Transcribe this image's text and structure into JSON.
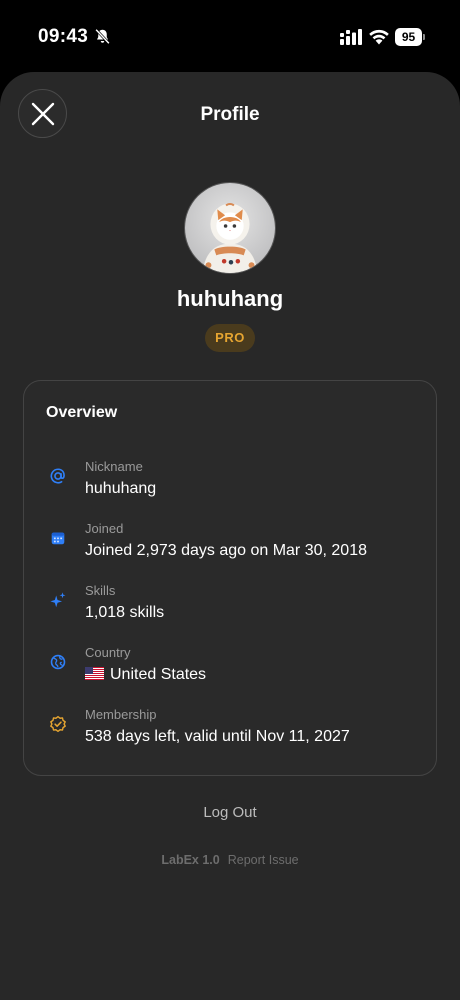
{
  "status_bar": {
    "time": "09:43",
    "battery": "95"
  },
  "header": {
    "title": "Profile"
  },
  "profile": {
    "username": "huhuhang",
    "badge": "PRO"
  },
  "overview": {
    "title": "Overview",
    "rows": [
      {
        "label": "Nickname",
        "value": "huhuhang",
        "icon": "at-icon"
      },
      {
        "label": "Joined",
        "value": "Joined 2,973 days ago on Mar 30, 2018",
        "icon": "calendar-icon"
      },
      {
        "label": "Skills",
        "value": "1,018 skills",
        "icon": "sparkles-icon"
      },
      {
        "label": "Country",
        "value": "United States",
        "icon": "globe-icon",
        "flag": "us-flag"
      },
      {
        "label": "Membership",
        "value": "538 days left, valid until Nov 11, 2027",
        "icon": "verified-badge-icon"
      }
    ]
  },
  "actions": {
    "logout": "Log Out"
  },
  "footer": {
    "version": "LabEx 1.0",
    "report": "Report Issue"
  },
  "colors": {
    "accent_blue": "#2f7ff7",
    "pro_gold": "#e6a531",
    "sheet_bg": "#282828"
  }
}
